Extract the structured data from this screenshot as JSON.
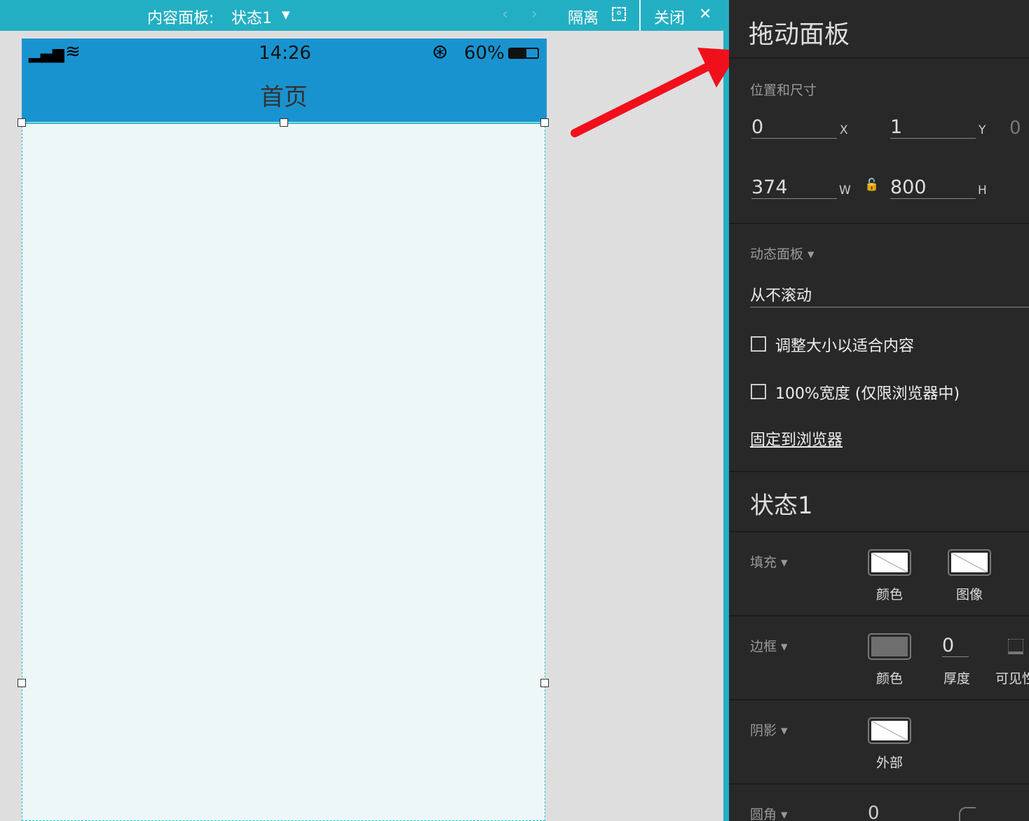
{
  "topbar": {
    "title": "内容面板:",
    "state": "状态1",
    "isolate": "隔离",
    "close": "关闭"
  },
  "phone": {
    "time": "14:26",
    "battery": "60%",
    "title": "首页"
  },
  "panel": {
    "title": "拖动面板",
    "pos_size_label": "位置和尺寸",
    "x": "0",
    "x_label": "X",
    "y": "1",
    "y_label": "Y",
    "rot": "0",
    "w": "374",
    "w_label": "W",
    "h": "800",
    "h_label": "H",
    "dyn_label": "动态面板",
    "scroll": "从不滚动",
    "fit_content": "调整大小以适合内容",
    "full_width": "100%宽度 (仅限浏览器中)",
    "pin": "固定到浏览器",
    "state_title": "状态1",
    "fill_label": "填充",
    "fill_color": "颜色",
    "fill_image": "图像",
    "border_label": "边框",
    "border_color": "颜色",
    "border_thickness": "0",
    "thickness_label": "厚度",
    "visibility_label": "可见性",
    "shadow_label": "阴影",
    "shadow_outer": "外部",
    "corner_label": "圆角",
    "corner_value": "0"
  },
  "colors": {
    "topbar": "#23afc3",
    "phone_header": "#1993d0",
    "panel_bg": "#282828",
    "arrow": "#f0101c"
  }
}
